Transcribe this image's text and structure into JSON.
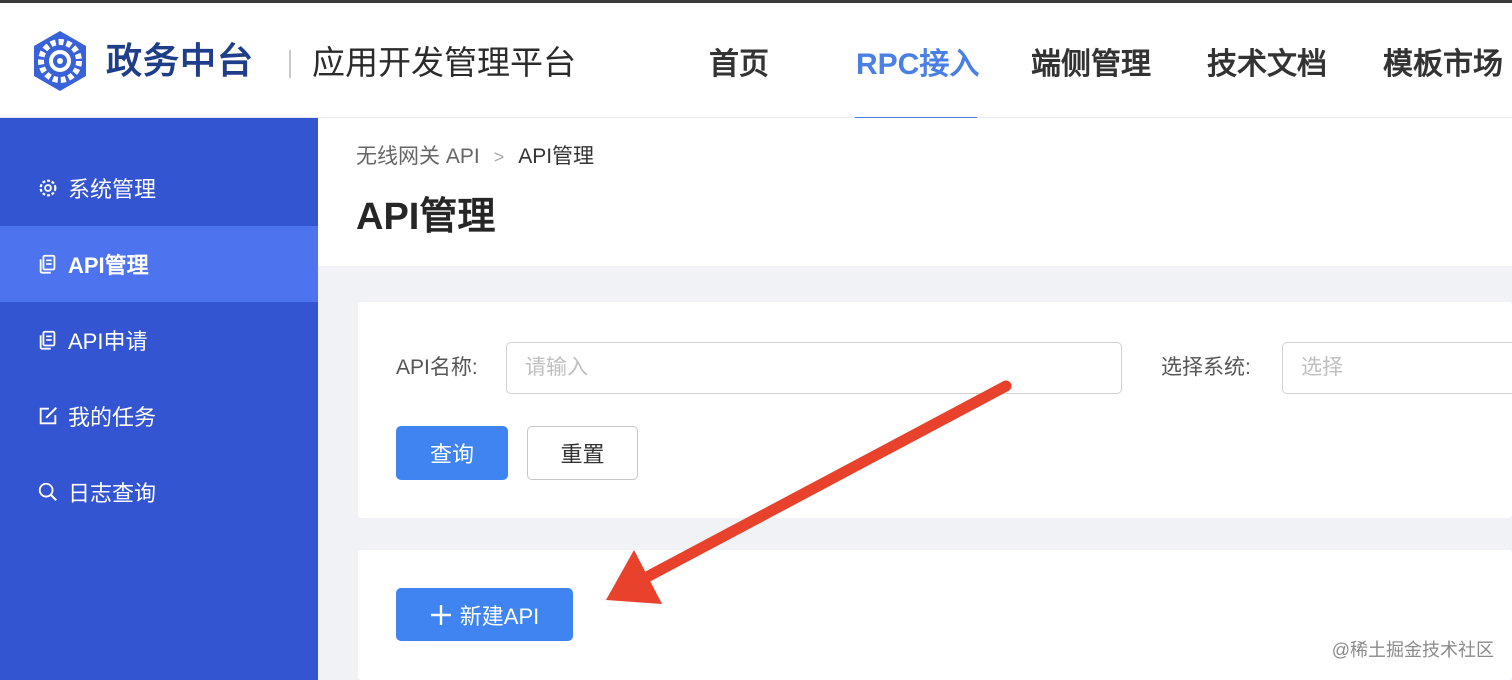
{
  "header": {
    "brand_name": "政务中台",
    "brand_subtitle": "应用开发管理平台",
    "nav": [
      {
        "label": "首页"
      },
      {
        "label": "RPC接入"
      },
      {
        "label": "端侧管理"
      },
      {
        "label": "技术文档"
      },
      {
        "label": "模板市场"
      }
    ],
    "active_nav": "RPC接入",
    "accent_color": "#4a7fe6"
  },
  "sidebar": {
    "background": "#3455d1",
    "items": [
      {
        "label": "系统管理",
        "icon": "gear-icon"
      },
      {
        "label": "API管理",
        "icon": "document-copy-icon"
      },
      {
        "label": "API申请",
        "icon": "document-copy-icon"
      },
      {
        "label": "我的任务",
        "icon": "edit-icon"
      },
      {
        "label": "日志查询",
        "icon": "search-icon"
      }
    ],
    "active_item": "API管理"
  },
  "breadcrumb": {
    "parent": "无线网关 API",
    "current": "API管理"
  },
  "page": {
    "title": "API管理"
  },
  "search_form": {
    "api_name_label": "API名称:",
    "api_name_placeholder": "请输入",
    "api_name_value": "",
    "system_label": "选择系统:",
    "system_placeholder": "选择",
    "query_button": "查询",
    "reset_button": "重置"
  },
  "list": {
    "new_api_button": "新建API"
  },
  "annotation": {
    "arrow_color": "#e8412c",
    "points_to": "new-api-button"
  },
  "watermark": "@稀土掘金技术社区"
}
